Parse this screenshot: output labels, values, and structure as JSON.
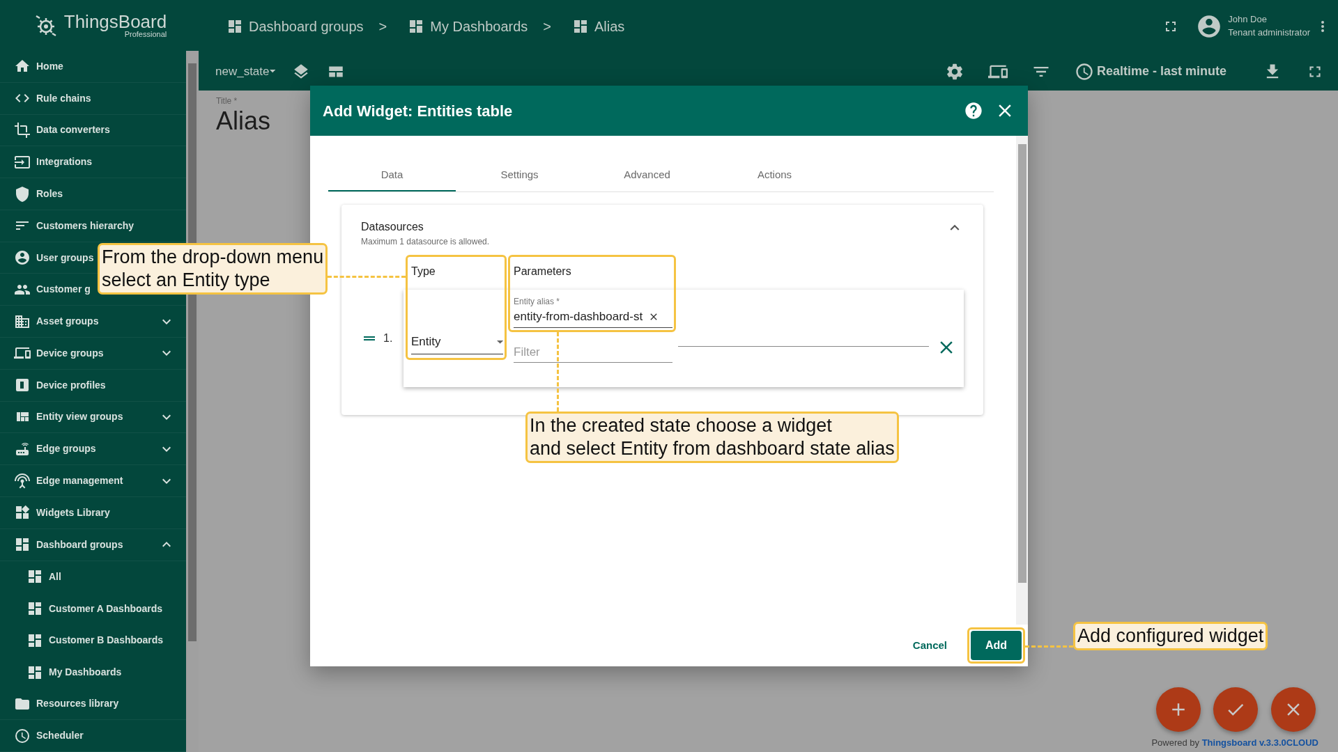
{
  "logo": {
    "name": "ThingsBoard",
    "edition": "Professional"
  },
  "sidebar": {
    "items": [
      {
        "label": "Home",
        "kind": "link"
      },
      {
        "label": "Rule chains",
        "kind": "link"
      },
      {
        "label": "Data converters",
        "kind": "link"
      },
      {
        "label": "Integrations",
        "kind": "link"
      },
      {
        "label": "Roles",
        "kind": "link"
      },
      {
        "label": "Customers hierarchy",
        "kind": "link"
      },
      {
        "label": "User groups",
        "kind": "link"
      },
      {
        "label": "Customer g",
        "kind": "link"
      },
      {
        "label": "Asset groups",
        "kind": "group",
        "expanded": false
      },
      {
        "label": "Device groups",
        "kind": "group",
        "expanded": false
      },
      {
        "label": "Device profiles",
        "kind": "link"
      },
      {
        "label": "Entity view groups",
        "kind": "group",
        "expanded": false
      },
      {
        "label": "Edge groups",
        "kind": "group",
        "expanded": false
      },
      {
        "label": "Edge management",
        "kind": "group",
        "expanded": false
      },
      {
        "label": "Widgets Library",
        "kind": "link"
      },
      {
        "label": "Dashboard groups",
        "kind": "group",
        "expanded": true,
        "children": [
          {
            "label": "All"
          },
          {
            "label": "Customer A Dashboards"
          },
          {
            "label": "Customer B Dashboards"
          },
          {
            "label": "My Dashboards"
          }
        ]
      },
      {
        "label": "Resources library",
        "kind": "link"
      },
      {
        "label": "Scheduler",
        "kind": "link"
      }
    ]
  },
  "breadcrumb": {
    "separator": ">",
    "items": [
      "Dashboard groups",
      "My Dashboards",
      "Alias"
    ]
  },
  "user": {
    "name": "John Doe",
    "role": "Tenant administrator"
  },
  "toolbar": {
    "state": "new_state",
    "timewindow": "Realtime - last minute"
  },
  "dashboard": {
    "title_label": "Title *",
    "title": "Alias"
  },
  "dialog": {
    "title": "Add Widget: Entities table",
    "tabs": [
      {
        "label": "Data",
        "selected": true
      },
      {
        "label": "Settings",
        "selected": false
      },
      {
        "label": "Advanced",
        "selected": false
      },
      {
        "label": "Actions",
        "selected": false
      }
    ],
    "datasources": {
      "title": "Datasources",
      "hint": "Maximum 1 datasource is allowed.",
      "expanded": true,
      "columns": [
        "Type",
        "Parameters"
      ],
      "rows": [
        {
          "index": "1.",
          "type": "Entity",
          "alias_label": "Entity alias *",
          "alias_value": "entity-from-dashboard-st",
          "filter_placeholder": "Filter"
        }
      ]
    },
    "buttons": {
      "cancel": "Cancel",
      "add": "Add"
    }
  },
  "annotations": [
    {
      "text": "From the drop-down menu\nselect an Entity type"
    },
    {
      "text": "In the created state choose a widget\nand select Entity from dashboard state alias"
    },
    {
      "text": "Add configured widget"
    }
  ],
  "footer": {
    "powered": "Powered by",
    "link": "Thingsboard v.3.3.0CLOUD"
  }
}
